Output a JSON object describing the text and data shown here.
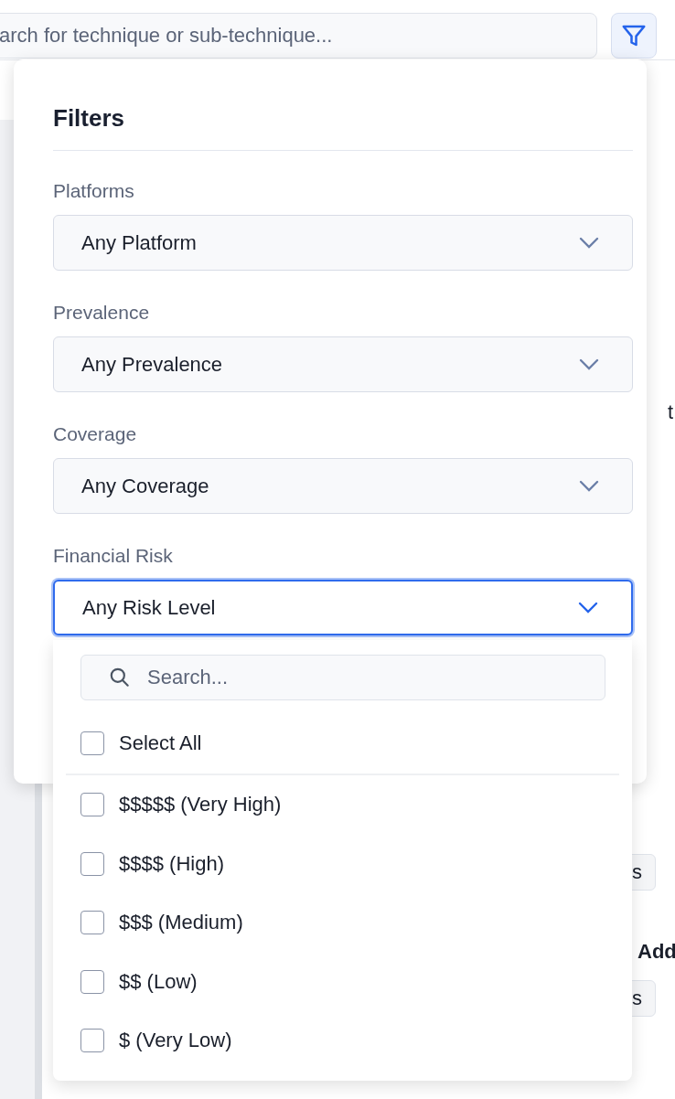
{
  "search": {
    "placeholder": "arch for technique or sub-technique..."
  },
  "background": {
    "fragments": [
      {
        "kind": "letter",
        "text": "t"
      },
      {
        "kind": "chip",
        "text": "s"
      },
      {
        "kind": "heading",
        "text": "Add"
      },
      {
        "kind": "chip",
        "text": "s"
      }
    ]
  },
  "filters": {
    "title": "Filters",
    "fields": [
      {
        "label": "Platforms",
        "value": "Any Platform",
        "focused": false
      },
      {
        "label": "Prevalence",
        "value": "Any Prevalence",
        "focused": false
      },
      {
        "label": "Coverage",
        "value": "Any Coverage",
        "focused": false
      },
      {
        "label": "Financial Risk",
        "value": "Any Risk Level",
        "focused": true
      }
    ]
  },
  "risk_menu": {
    "search_placeholder": "Search...",
    "select_all": {
      "label": "Select All",
      "checked": false
    },
    "options": [
      {
        "label": "$$$$$ (Very High)",
        "checked": false
      },
      {
        "label": "$$$$ (High)",
        "checked": false
      },
      {
        "label": "$$$ (Medium)",
        "checked": false
      },
      {
        "label": "$$ (Low)",
        "checked": false
      },
      {
        "label": "$ (Very Low)",
        "checked": false
      }
    ]
  }
}
